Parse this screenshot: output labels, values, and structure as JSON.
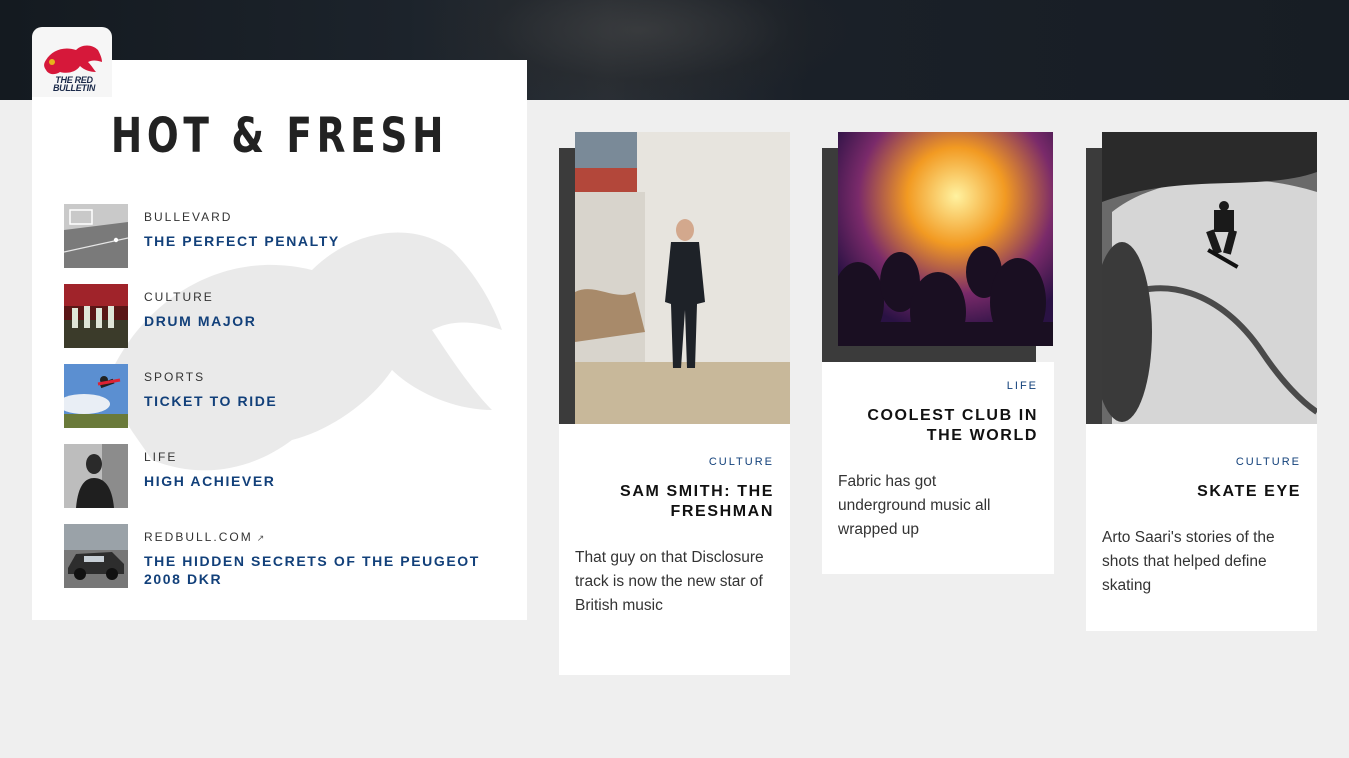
{
  "brand": {
    "logo_text": "THE RED BULLETIN"
  },
  "panel": {
    "title": "HOT & FRESH",
    "items": [
      {
        "category": "BULLEVARD",
        "title": "THE PERFECT PENALTY"
      },
      {
        "category": "CULTURE",
        "title": "DRUM MAJOR"
      },
      {
        "category": "SPORTS",
        "title": "TICKET TO RIDE"
      },
      {
        "category": "LIFE",
        "title": "HIGH ACHIEVER"
      },
      {
        "category": "REDBULL.COM",
        "external_icon": "external-link-icon",
        "title": "THE HIDDEN SECRETS OF THE PEUGEOT 2008 DKR"
      }
    ]
  },
  "cards": [
    {
      "category": "CULTURE",
      "title": "SAM SMITH: THE FRESHMAN",
      "description": "That guy on that Disclosure track is now the new star of British music"
    },
    {
      "category": "LIFE",
      "title": "COOLEST CLUB IN THE WORLD",
      "description": "Fabric has got underground music all wrapped up"
    },
    {
      "category": "CULTURE",
      "title": "SKATE EYE",
      "description": "Arto Saari's stories of the shots that helped define skating"
    }
  ],
  "colors": {
    "accent": "#12407a",
    "brand_red": "#d6183a",
    "background": "#efefef"
  }
}
